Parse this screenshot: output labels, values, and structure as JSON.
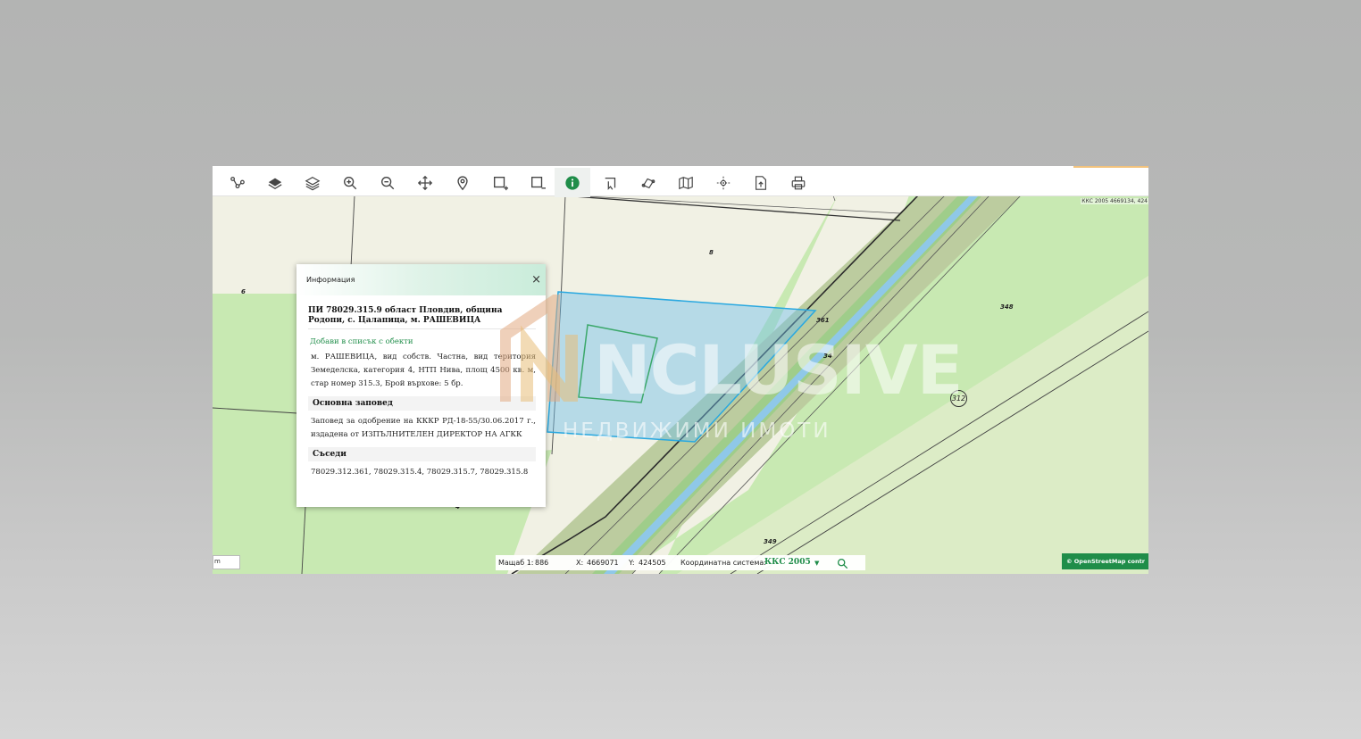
{
  "toolbar": {
    "tools": [
      "measure-tool",
      "layers",
      "layer-list",
      "zoom-in",
      "zoom-out",
      "pan",
      "locate",
      "draw-rectangle-add",
      "draw-rectangle-remove",
      "info",
      "select",
      "draw-polygon",
      "map",
      "coordinates",
      "export",
      "print"
    ],
    "active_tool": "info"
  },
  "map": {
    "coordinates_top": "ККС 2005 4669134, 424",
    "parcel_labels": [
      "6",
      "8",
      "348",
      "361",
      "34",
      "349",
      "4"
    ],
    "circled_label": "312"
  },
  "popup": {
    "header": "Информация",
    "close": "×",
    "title": "ПИ 78029.315.9 област Пловдив, община Родопи, с. Цалапица, м. РАШЕВИЦА",
    "add_link": "Добави в списък с обекти",
    "description": "м. РАШЕВИЦА, вид собств. Частна, вид територия Земеделска, категория 4, НТП Нива, площ 4500 кв. м, стар номер 315.3, Брой върхове: 5 бр.",
    "order_heading": "Основна заповед",
    "order_text": "Заповед за одобрение на КККР РД-18-55/30.06.2017 г., издадена от ИЗПЪЛНИТЕЛЕН ДИРЕКТОР НА АГКК",
    "neighbors_heading": "Съседи",
    "neighbors_text": "78029.312.361, 78029.315.4, 78029.315.7, 78029.315.8"
  },
  "status": {
    "scale_label": "Мащаб 1:",
    "scale_value": "886",
    "x_label": "X:",
    "x_value": "4669071",
    "y_label": "Y:",
    "y_value": "424505",
    "crs_label": "Координатна система:",
    "crs_value": "ККС 2005",
    "crs_arrow": "▼"
  },
  "scale_input": "m",
  "attribution": "© OpenStreetMap contr",
  "watermark": {
    "text": "NCLUSIVE",
    "subtitle": "НЕДВИЖИМИ ИМОТИ"
  },
  "colors": {
    "accent": "#1f8d49",
    "selected_parcel": "#29a8e0",
    "field_light": "#f1f1e4",
    "field_green": "#c8e9b2"
  }
}
